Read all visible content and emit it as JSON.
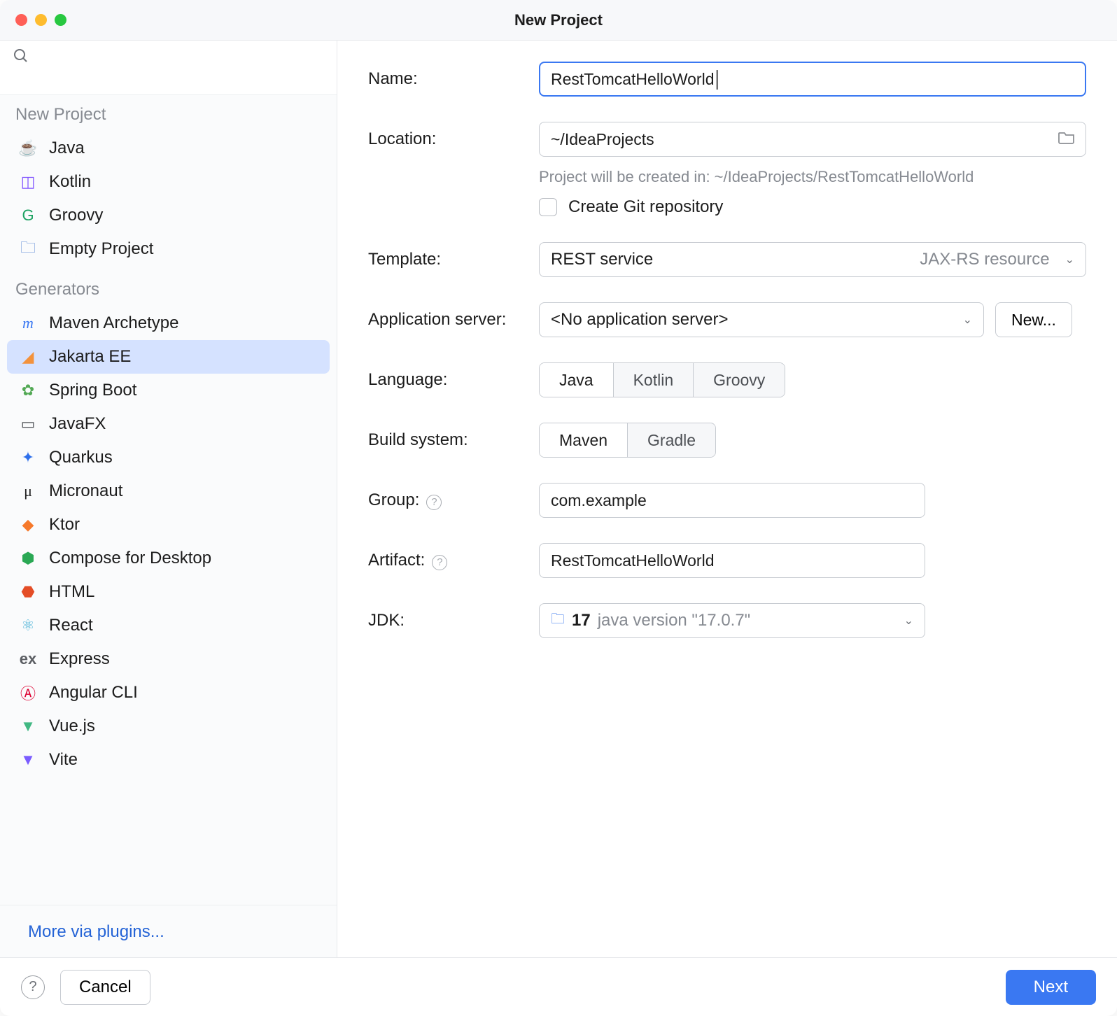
{
  "window_title": "New Project",
  "sidebar": {
    "search_placeholder": "",
    "section_new_project": "New Project",
    "new_project_items": [
      {
        "label": "Java",
        "icon": "java"
      },
      {
        "label": "Kotlin",
        "icon": "kotlin"
      },
      {
        "label": "Groovy",
        "icon": "groovy"
      },
      {
        "label": "Empty Project",
        "icon": "empty"
      }
    ],
    "section_generators": "Generators",
    "generator_items": [
      {
        "label": "Maven Archetype",
        "icon": "maven"
      },
      {
        "label": "Jakarta EE",
        "icon": "jakarta",
        "selected": true
      },
      {
        "label": "Spring Boot",
        "icon": "spring"
      },
      {
        "label": "JavaFX",
        "icon": "javafx"
      },
      {
        "label": "Quarkus",
        "icon": "quarkus"
      },
      {
        "label": "Micronaut",
        "icon": "micronaut"
      },
      {
        "label": "Ktor",
        "icon": "ktor"
      },
      {
        "label": "Compose for Desktop",
        "icon": "compose"
      },
      {
        "label": "HTML",
        "icon": "html"
      },
      {
        "label": "React",
        "icon": "react"
      },
      {
        "label": "Express",
        "icon": "express"
      },
      {
        "label": "Angular CLI",
        "icon": "angular"
      },
      {
        "label": "Vue.js",
        "icon": "vue"
      },
      {
        "label": "Vite",
        "icon": "vite"
      }
    ],
    "more_plugins": "More via plugins..."
  },
  "form": {
    "name_label": "Name:",
    "name_value": "RestTomcatHelloWorld",
    "location_label": "Location:",
    "location_value": "~/IdeaProjects",
    "location_hint": "Project will be created in: ~/IdeaProjects/RestTomcatHelloWorld",
    "git_checkbox_label": "Create Git repository",
    "git_checked": false,
    "template_label": "Template:",
    "template_value": "REST service",
    "template_meta": "JAX-RS resource",
    "appserver_label": "Application server:",
    "appserver_value": "<No application server>",
    "appserver_new_button": "New...",
    "language_label": "Language:",
    "language_options": [
      "Java",
      "Kotlin",
      "Groovy"
    ],
    "language_selected": "Java",
    "build_label": "Build system:",
    "build_options": [
      "Maven",
      "Gradle"
    ],
    "build_selected": "Maven",
    "group_label": "Group:",
    "group_value": "com.example",
    "artifact_label": "Artifact:",
    "artifact_value": "RestTomcatHelloWorld",
    "jdk_label": "JDK:",
    "jdk_display_primary": "17",
    "jdk_display_secondary": "java version \"17.0.7\""
  },
  "footer": {
    "cancel": "Cancel",
    "next": "Next"
  },
  "icons": {
    "java": "☕",
    "kotlin": "◫",
    "groovy": "G",
    "empty": "🗀",
    "maven": "m",
    "jakarta": "◢",
    "spring": "✿",
    "javafx": "▭",
    "quarkus": "✦",
    "micronaut": "μ",
    "ktor": "◆",
    "compose": "⬢",
    "html": "⬣",
    "react": "⚛",
    "express": "ex",
    "angular": "Ⓐ",
    "vue": "▼",
    "vite": "▼"
  }
}
